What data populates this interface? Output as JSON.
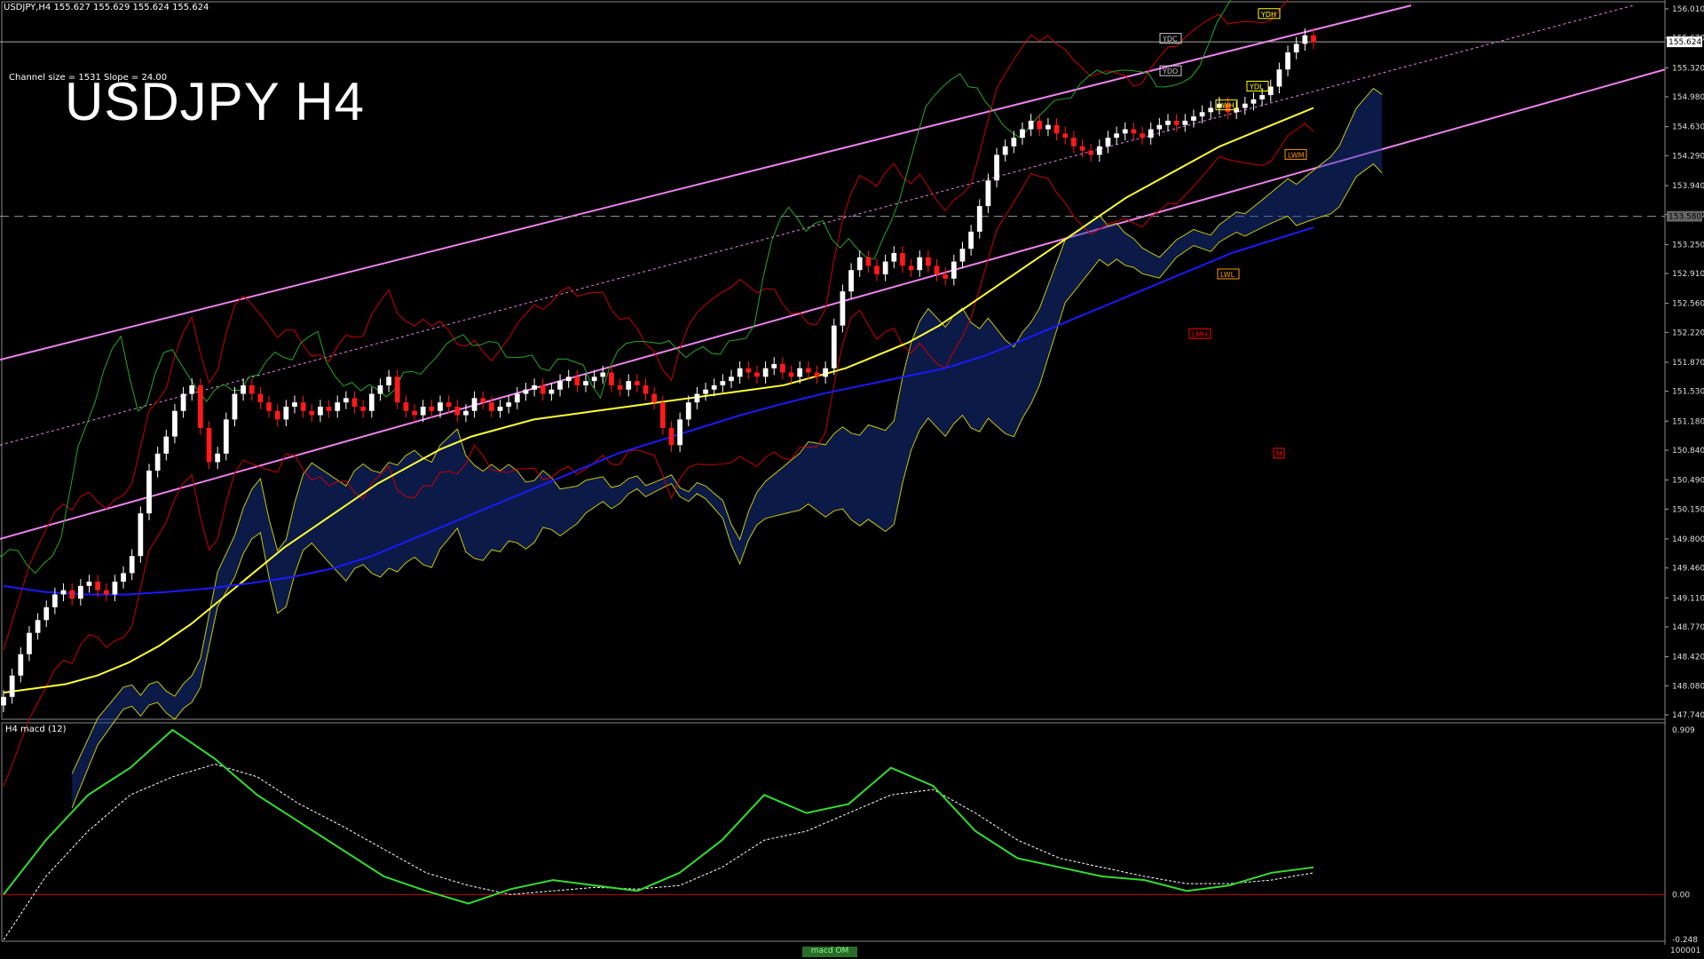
{
  "header": {
    "symbol_info": "USDJPY,H4  155.627 155.629 155.624 155.624",
    "channel_info": "Channel size = 1531 Slope = 24.00",
    "title": "USDJPY H4"
  },
  "subpane": {
    "label": "H4  macd (12)",
    "tab_label": "macd OM",
    "scale_end": "100001"
  },
  "colors": {
    "background": "#000000",
    "bull_candle": "#ffffff",
    "bear_candle": "#ff1a1a",
    "channel": "#ee82ee",
    "ema_yellow": "#ffff33",
    "ema_blue": "#1a1aff",
    "bollinger": "#cc0000",
    "kumo_edge": "#c8c800",
    "kumo_fill": "#1a3aa0",
    "chikou": "#22aa22",
    "macd_line": "#33dd33",
    "signal_line": "#ffffff",
    "zero_line": "#cc0000"
  },
  "chart_data": [
    {
      "type": "line",
      "title": "USDJPY H4",
      "ylim": [
        147.74,
        156.01
      ],
      "y_ticks": [
        "156.010",
        "155.670",
        "155.320",
        "154.980",
        "154.630",
        "154.290",
        "153.940",
        "153.600",
        "153.250",
        "152.910",
        "152.560",
        "152.220",
        "151.870",
        "151.530",
        "151.180",
        "150.840",
        "150.490",
        "150.150",
        "149.800",
        "149.460",
        "149.110",
        "148.770",
        "148.420",
        "148.080",
        "147.740"
      ],
      "current_price": "155.624",
      "hline_price": "153.580",
      "x": [
        0,
        4,
        8,
        12,
        16,
        20,
        24,
        28,
        32,
        36,
        40,
        44,
        48,
        52,
        56,
        60,
        64,
        68,
        72,
        76,
        80,
        84,
        88,
        92,
        96,
        100,
        104,
        108,
        112,
        116,
        120,
        124,
        128,
        132,
        136,
        140,
        144,
        148,
        152,
        156,
        160,
        164,
        168,
        172,
        176,
        180,
        184,
        188,
        192,
        196,
        200,
        204,
        208,
        212,
        216,
        220,
        224,
        228,
        232,
        236,
        240,
        244,
        248,
        252,
        256,
        260,
        264,
        268,
        272,
        276,
        280,
        284,
        288,
        292,
        296,
        300,
        304,
        308,
        312,
        316,
        320,
        324,
        328,
        332,
        336,
        340,
        344,
        348,
        352,
        356,
        360,
        364,
        368,
        372,
        376,
        380,
        384,
        388,
        392,
        396,
        400,
        404,
        408,
        412,
        416,
        420,
        424,
        428,
        432,
        436,
        440,
        444,
        448,
        452,
        456,
        460,
        464,
        468,
        472,
        476,
        480,
        484,
        488,
        492,
        496,
        500,
        504,
        508,
        512,
        516,
        520,
        524,
        528,
        532,
        536,
        540,
        544,
        548,
        552,
        556,
        560,
        564,
        568,
        572,
        576,
        580,
        584,
        588,
        592,
        596,
        600,
        604,
        608,
        612,
        616,
        620,
        624,
        628,
        632,
        636,
        640,
        644,
        648,
        652,
        656,
        660,
        664,
        668,
        672,
        676,
        680,
        684,
        688,
        692,
        696,
        700,
        704,
        708,
        712,
        716,
        720,
        724,
        728,
        732,
        736,
        740,
        744,
        748,
        752,
        756,
        760,
        764,
        768,
        772,
        776,
        780,
        784,
        788,
        792,
        796,
        800,
        804,
        808,
        812,
        816,
        820,
        824,
        828,
        832,
        836,
        840,
        844,
        848,
        852,
        856,
        860,
        864,
        868,
        872,
        876,
        880,
        884,
        888,
        892,
        896,
        900
      ],
      "series": [
        {
          "key": "close",
          "values": [
            147.95,
            148.2,
            148.45,
            148.7,
            148.85,
            149.0,
            149.15,
            149.2,
            149.1,
            149.25,
            149.3,
            149.2,
            149.15,
            149.3,
            149.4,
            149.6,
            150.1,
            150.6,
            150.8,
            151.0,
            151.3,
            151.5,
            151.6,
            151.1,
            150.7,
            150.8,
            151.2,
            151.5,
            151.6,
            151.5,
            151.4,
            151.3,
            151.2,
            151.35,
            151.4,
            151.3,
            151.25,
            151.35,
            151.3,
            151.4,
            151.45,
            151.35,
            151.3,
            151.5,
            151.6,
            151.7,
            151.4,
            151.3,
            151.25,
            151.35,
            151.3,
            151.4,
            151.35,
            151.25,
            151.3,
            151.45,
            151.4,
            151.3,
            151.35,
            151.4,
            151.5,
            151.55,
            151.6,
            151.5,
            151.55,
            151.65,
            151.7,
            151.6,
            151.65,
            151.7,
            151.75,
            151.6,
            151.55,
            151.65,
            151.6,
            151.5,
            151.4,
            151.1,
            150.9,
            151.2,
            151.4,
            151.5,
            151.55,
            151.6,
            151.65,
            151.7,
            151.8,
            151.75,
            151.7,
            151.8,
            151.85,
            151.75,
            151.7,
            151.8,
            151.75,
            151.7,
            151.8,
            152.3,
            152.7,
            152.95,
            153.1,
            153.0,
            152.9,
            153.05,
            153.15,
            153.0,
            152.95,
            153.1,
            153.0,
            152.9,
            152.85,
            153.05,
            153.2,
            153.4,
            153.7,
            154.0,
            154.3,
            154.4,
            154.5,
            154.6,
            154.7,
            154.6,
            154.65,
            154.55,
            154.5,
            154.4,
            154.35,
            154.3,
            154.4,
            154.5,
            154.55,
            154.6,
            154.55,
            154.5,
            154.6,
            154.65,
            154.7,
            154.65,
            154.7,
            154.75,
            154.8,
            154.85,
            154.9,
            154.8,
            154.85,
            154.9,
            154.95,
            155.0,
            155.1,
            155.3,
            155.5,
            155.6,
            155.7,
            155.62
          ]
        },
        {
          "key": "ema_yellow",
          "values": [
            148.0,
            148.05,
            148.1,
            148.2,
            148.35,
            148.55,
            148.8,
            149.1,
            149.4,
            149.7,
            149.95,
            150.2,
            150.45,
            150.65,
            150.85,
            151.0,
            151.1,
            151.2,
            151.25,
            151.3,
            151.35,
            151.4,
            151.45,
            151.5,
            151.55,
            151.6,
            151.7,
            151.8,
            151.95,
            152.1,
            152.3,
            152.55,
            152.8,
            153.05,
            153.3,
            153.55,
            153.8,
            154.0,
            154.2,
            154.4,
            154.55,
            154.7,
            154.85
          ]
        },
        {
          "key": "ema_blue",
          "values": [
            149.25,
            149.18,
            149.15,
            149.15,
            149.18,
            149.22,
            149.28,
            149.35,
            149.45,
            149.6,
            149.8,
            150.0,
            150.2,
            150.4,
            150.6,
            150.8,
            150.95,
            151.1,
            151.25,
            151.38,
            151.5,
            151.6,
            151.7,
            151.8,
            151.95,
            152.15,
            152.35,
            152.55,
            152.75,
            152.95,
            153.15,
            153.3,
            153.45
          ]
        },
        {
          "key": "macd",
          "values": [
            0.0,
            0.3,
            0.55,
            0.7,
            0.909,
            0.75,
            0.55,
            0.4,
            0.25,
            0.1,
            0.02,
            -0.05,
            0.03,
            0.08,
            0.05,
            0.02,
            0.12,
            0.3,
            0.55,
            0.45,
            0.5,
            0.7,
            0.6,
            0.35,
            0.2,
            0.15,
            0.1,
            0.08,
            0.02,
            0.05,
            0.12,
            0.15
          ]
        },
        {
          "key": "signal",
          "values": [
            -0.25,
            0.1,
            0.35,
            0.55,
            0.65,
            0.72,
            0.65,
            0.5,
            0.38,
            0.25,
            0.12,
            0.05,
            0.0,
            0.02,
            0.04,
            0.03,
            0.05,
            0.15,
            0.3,
            0.35,
            0.45,
            0.55,
            0.58,
            0.45,
            0.3,
            0.2,
            0.15,
            0.1,
            0.06,
            0.06,
            0.08,
            0.12
          ]
        }
      ]
    },
    {
      "type": "line",
      "title": "H4  macd (12)",
      "ylim": [
        -0.248,
        0.909
      ],
      "y_ticks": [
        "0.909",
        "0.00",
        "-0.248"
      ]
    }
  ],
  "labels": {
    "ydh": "YDH",
    "ydc": "YDC",
    "ydo": "YDO",
    "ydl": "YDL",
    "lwh": "LWH",
    "lwl": "LWL",
    "lwm": "LWM",
    "lmh": "LMH",
    "m": "M",
    "vwap": "VWAP"
  }
}
